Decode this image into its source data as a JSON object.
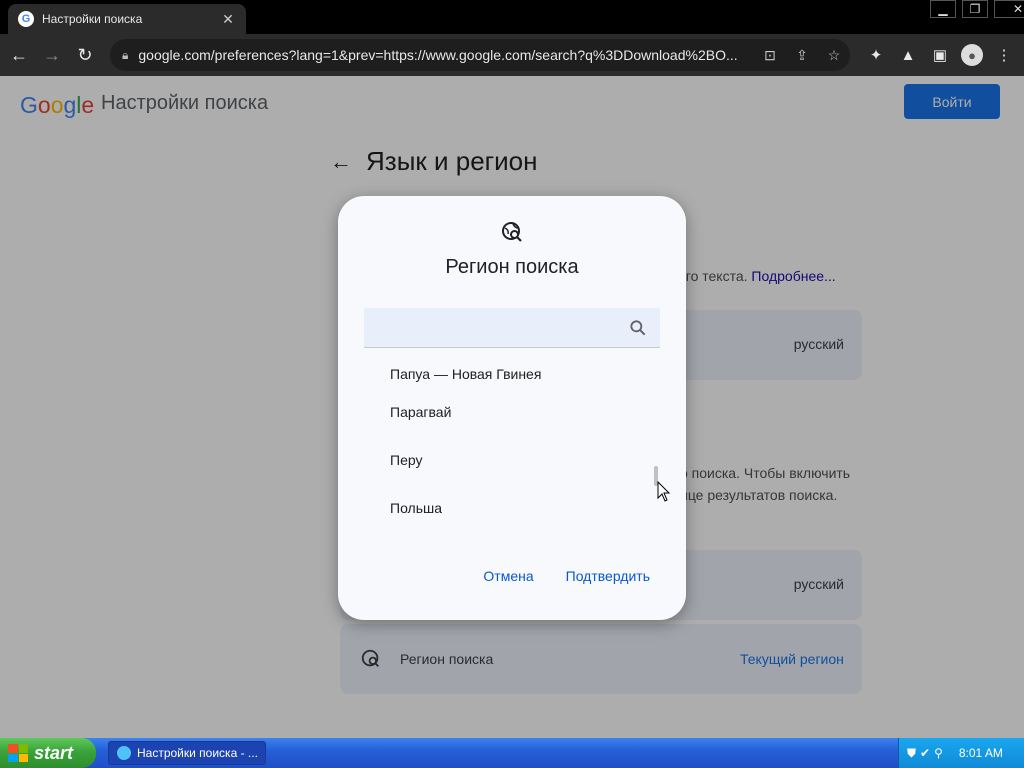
{
  "browser": {
    "tab_title": "Настройки поиска",
    "url": "google.com/preferences?lang=1&prev=https://www.google.com/search?q%3DDownload%2BO..."
  },
  "header": {
    "logo_letters": [
      "G",
      "o",
      "o",
      "g",
      "l",
      "e"
    ],
    "logo_colors": [
      "#4285f4",
      "#ea4335",
      "#fbbc05",
      "#4285f4",
      "#34a853",
      "#ea4335"
    ],
    "title": "Настройки поиска",
    "login_label": "Войти"
  },
  "section": {
    "title": "Язык и регион",
    "desc1_text": "ого текста. ",
    "desc1_link": "Подробнее...",
    "lang_value_1": "русский",
    "desc2_line1": "о поиска. Чтобы включить",
    "desc2_line2": "ице результатов поиска.",
    "lang_value_2": "русский",
    "region_label": "Регион поиска",
    "region_value": "Текущий регион"
  },
  "dialog": {
    "title": "Регион поиска",
    "search_placeholder": "",
    "items": [
      "Папуа — Новая Гвинея",
      "Парагвай",
      "Перу",
      "Польша"
    ],
    "cancel_label": "Отмена",
    "confirm_label": "Подтвердить"
  },
  "taskbar": {
    "start_label": "start",
    "task_label": "Настройки поиска - ...",
    "clock": "8:01 AM"
  }
}
